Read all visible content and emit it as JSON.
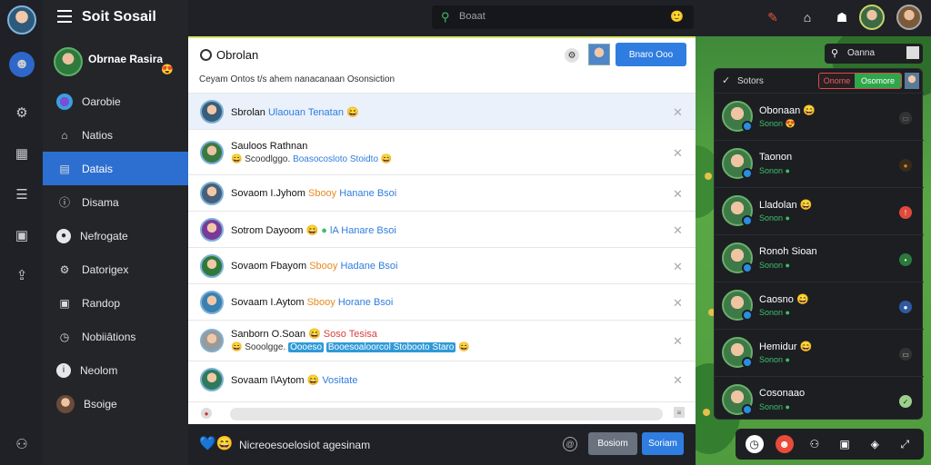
{
  "app": {
    "title": "Soit Sosail"
  },
  "profile": {
    "name": "Obrnae Rasira"
  },
  "sidebar": {
    "items": [
      {
        "label": "Oarobie"
      },
      {
        "label": "Natios"
      },
      {
        "label": "Datais"
      },
      {
        "label": "Disama"
      },
      {
        "label": "Nefrogate"
      },
      {
        "label": "Datorigex"
      },
      {
        "label": "Randop"
      },
      {
        "label": "Nobiiâtions"
      },
      {
        "label": "Neolom"
      },
      {
        "label": "Bsoige"
      }
    ],
    "active_index": 2
  },
  "search": {
    "placeholder": "Boaat"
  },
  "main": {
    "title": "Obrolan",
    "button": "Bnaro Ooo",
    "subtitle": "Ceyam Ontos t/s ahem nanacanaan Osonsiction",
    "rows": [
      {
        "l1_a": "Sbrolan",
        "l1_b": "Ulaouan Tenatan",
        "l2": ""
      },
      {
        "l1_a": "Sauloos Rathnan",
        "l1_b": "",
        "l2_a": "Scoodlggo.",
        "l2_b": "Boasocosloto Stoidto"
      },
      {
        "l1_a": "Sovaom I.Jyhom",
        "l1_b": "Sbooy",
        "l1_c": "Hanane Bsoi",
        "l2": ""
      },
      {
        "l1_a": "Sotrom Dayoom",
        "l1_b": "",
        "l1_c": "lA Hanare Bsoi",
        "l2": ""
      },
      {
        "l1_a": "Sovaom Fbayom",
        "l1_b": "Sbooy",
        "l1_c": "Hadane Bsoi",
        "l2": ""
      },
      {
        "l1_a": "Sovaam I.Aytom",
        "l1_b": "Sbooy",
        "l1_c": "Horane Bsoi",
        "l2": ""
      },
      {
        "l1_a": "Sanborn O.Soan",
        "l1_b": "Soso Tesisa",
        "l2_a": "Sooolgge.",
        "l2_b": "Oooeso",
        "l2_c": "Booesoaloorcol Stobooto Staro"
      },
      {
        "l1_a": "Sovaam I\\Aytom",
        "l1_b": "",
        "l1_c": "Vositate",
        "l2": ""
      }
    ]
  },
  "composer": {
    "text": "Nicreoesoelosiot agesinam",
    "btn_secondary": "Bosiom",
    "btn_primary": "Soriam"
  },
  "status": {
    "label": "Oanna"
  },
  "friends": {
    "title": "Sotors",
    "tab1": "Onome",
    "tab2": "Osomore",
    "list": [
      {
        "name": "Obonaan",
        "status": "Sonon"
      },
      {
        "name": "Taonon",
        "status": "Sonon"
      },
      {
        "name": "Lladolan",
        "status": "Sonon"
      },
      {
        "name": "Ronoh Sioan",
        "status": "Sonon"
      },
      {
        "name": "Caosno",
        "status": "Sonon"
      },
      {
        "name": "Hemidur",
        "status": "Sonon"
      },
      {
        "name": "Cosonaao",
        "status": "Sonon"
      }
    ]
  },
  "colors": {
    "accent": "#2f7de0",
    "online": "#3ec067",
    "panel": "#1c1e22"
  },
  "icons": [
    "hamburger-icon",
    "search-icon",
    "bell-icon",
    "home-icon",
    "user-icon",
    "chat-icon",
    "settings-icon"
  ]
}
